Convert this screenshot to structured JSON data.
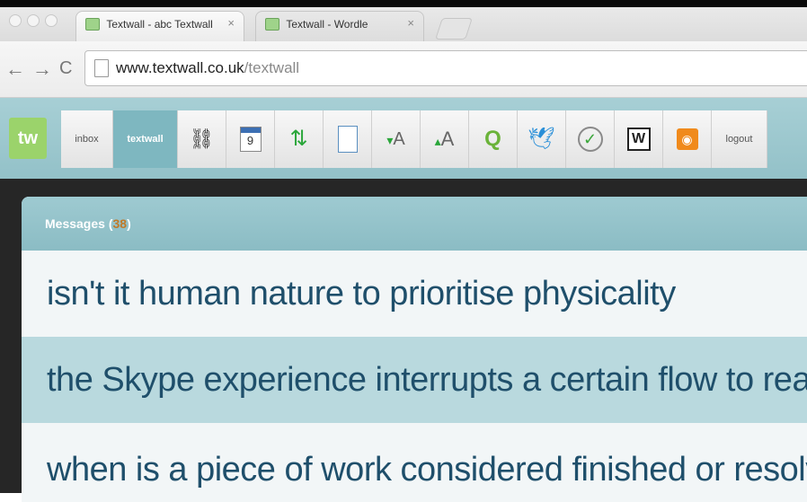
{
  "browser": {
    "tabs": [
      {
        "title": "Textwall - abc Textwall",
        "close": "×"
      },
      {
        "title": "Textwall - Wordle",
        "close": "×"
      }
    ],
    "nav": {
      "back": "←",
      "forward": "→",
      "reload": "C"
    },
    "url": {
      "host": "www.textwall.co.uk",
      "path": "/textwall"
    }
  },
  "app": {
    "logo": "tw",
    "toolbar": {
      "inbox": "inbox",
      "textwall": "textwall",
      "logout": "logout",
      "icons": [
        {
          "name": "binoculars-icon",
          "glyph": "🔭"
        },
        {
          "name": "calendar-icon",
          "glyph": "9"
        },
        {
          "name": "refresh-arrows-icon",
          "glyph": "⇅"
        },
        {
          "name": "notepad-icon",
          "glyph": "▤"
        },
        {
          "name": "text-down-icon",
          "glyph": "A"
        },
        {
          "name": "text-up-icon",
          "glyph": "A"
        },
        {
          "name": "search-q-icon",
          "glyph": "Q"
        },
        {
          "name": "twitter-bird-icon",
          "glyph": "🐦"
        },
        {
          "name": "check-circle-icon",
          "glyph": "✓"
        },
        {
          "name": "wordle-w-icon",
          "glyph": "W"
        },
        {
          "name": "rss-feed-icon",
          "glyph": "◉"
        }
      ]
    }
  },
  "messages": {
    "header_label": "Messages",
    "count": "38",
    "items": [
      "isn't it human nature to prioritise physicality",
      "the Skype experience interrupts a certain flow to reality",
      "when is a piece of work considered finished or resolved?"
    ]
  },
  "colors": {
    "toolbar_bg": "#9cc8ce",
    "active_tab": "#7eb7c0",
    "message_text": "#1f4f6b",
    "alt_row": "#b9d9de",
    "count_orange": "#c07a2a"
  }
}
